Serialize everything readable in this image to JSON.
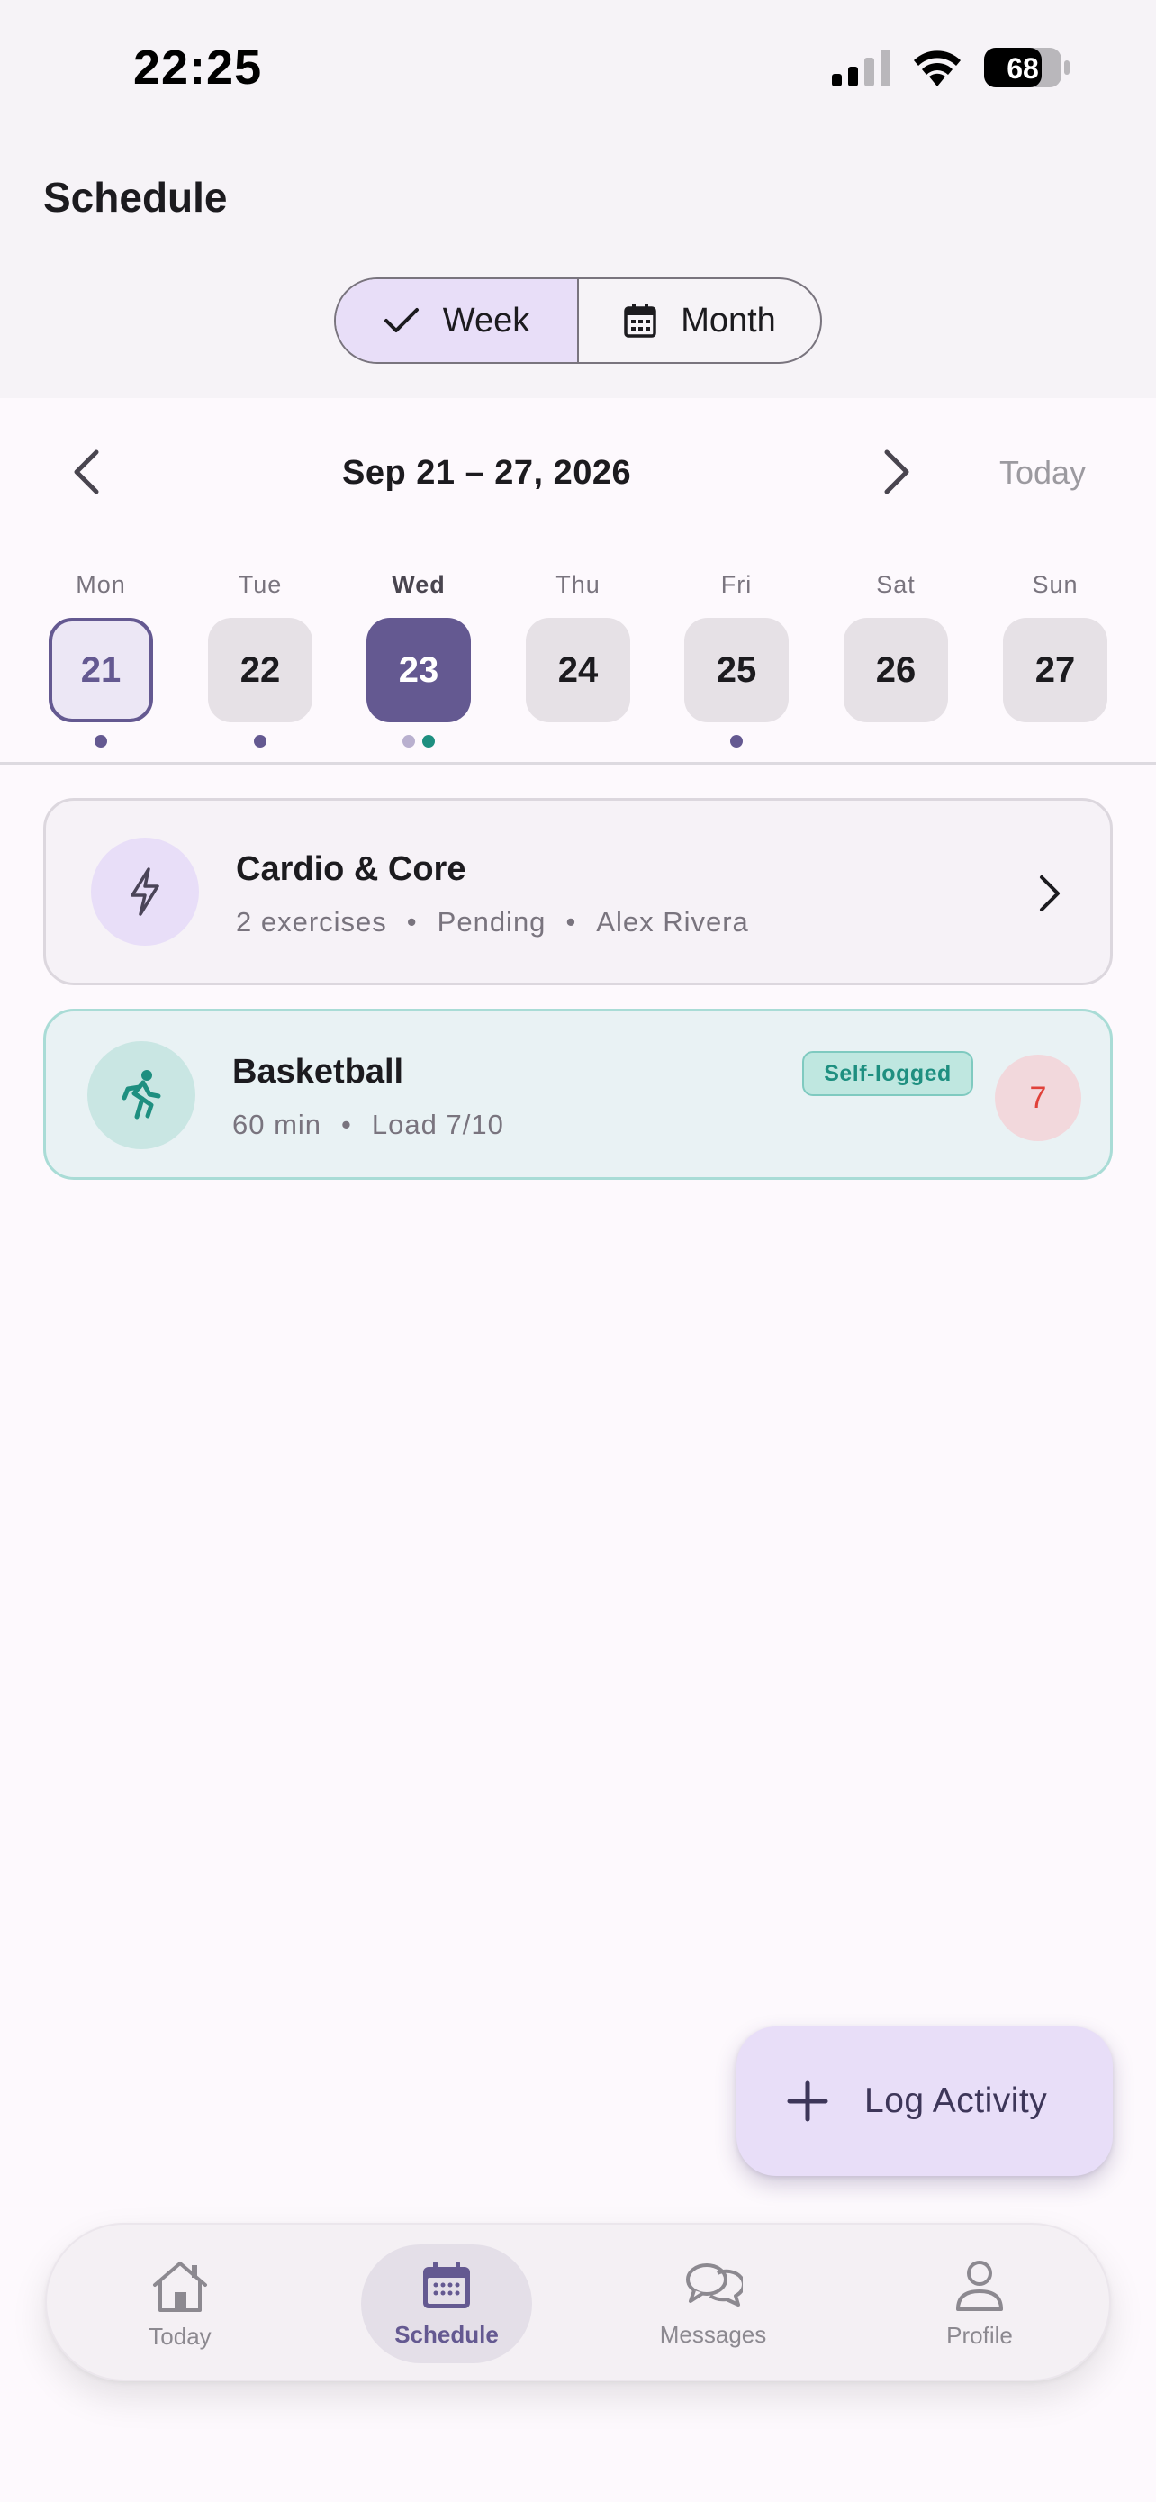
{
  "status_bar": {
    "time": "22:25",
    "battery": "68"
  },
  "header": {
    "title": "Schedule"
  },
  "view_toggle": {
    "week_label": "Week",
    "month_label": "Month",
    "selected": "Week"
  },
  "week_nav": {
    "range": "Sep 21 – 27, 2026",
    "today_label": "Today"
  },
  "days": [
    {
      "name": "Mon",
      "date": "21"
    },
    {
      "name": "Tue",
      "date": "22"
    },
    {
      "name": "Wed",
      "date": "23"
    },
    {
      "name": "Thu",
      "date": "24"
    },
    {
      "name": "Fri",
      "date": "25"
    },
    {
      "name": "Sat",
      "date": "26"
    },
    {
      "name": "Sun",
      "date": "27"
    }
  ],
  "cards": [
    {
      "title": "Cardio & Core",
      "meta": [
        "2 exercises",
        "Pending",
        "Alex Rivera"
      ],
      "icon": "lightning-icon"
    },
    {
      "title": "Basketball",
      "meta": [
        "60 min",
        "Load 7/10"
      ],
      "badge": "Self-logged",
      "load": "7",
      "icon": "running-icon"
    }
  ],
  "fab": {
    "label": "Log Activity"
  },
  "bottom_nav": {
    "items": [
      {
        "label": "Today",
        "icon": "home-icon"
      },
      {
        "label": "Schedule",
        "icon": "calendar-icon"
      },
      {
        "label": "Messages",
        "icon": "chat-icon"
      },
      {
        "label": "Profile",
        "icon": "person-icon"
      }
    ],
    "active": "Schedule"
  },
  "colors": {
    "primary": "#645991",
    "primary_container": "#e8def8",
    "teal": "#1e8f80",
    "load_red": "#e0413a"
  }
}
